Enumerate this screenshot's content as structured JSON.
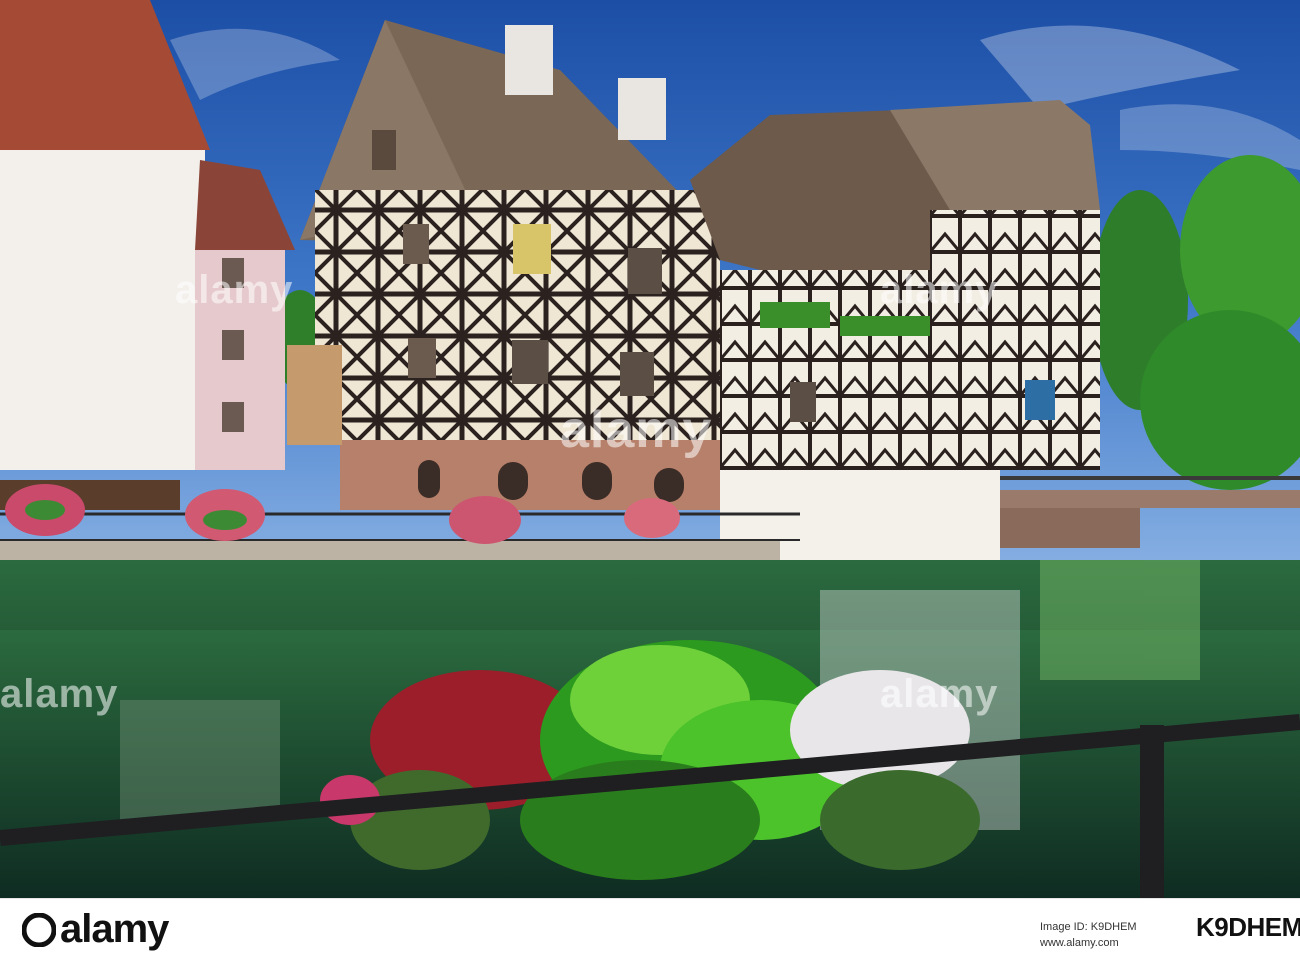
{
  "watermark": {
    "brand": "alamy"
  },
  "footer": {
    "brand": "alamy",
    "stock_id_label": "Image ID: K9DHEM",
    "stock_code": "K9DHEM",
    "url": "www.alamy.com"
  },
  "colors": {
    "sky": "#2f66b8",
    "water": "#1f5a45",
    "timber": "#2b2220",
    "plaster": "#f2ede2",
    "roof": "#6f5a4a",
    "foliage": "#3aa12c"
  }
}
